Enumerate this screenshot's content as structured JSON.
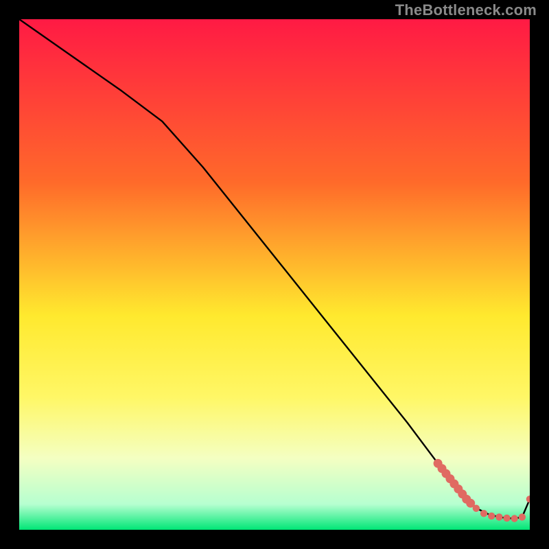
{
  "attribution": "TheBottleneck.com",
  "colors": {
    "line": "#000000",
    "markers": "#e06a62",
    "frame": "#000000",
    "gradient_top": "#ff1a44",
    "gradient_mid_upper": "#ff8a2a",
    "gradient_mid": "#ffe92e",
    "gradient_lower": "#f7ffb0",
    "gradient_bottom": "#00e676"
  },
  "chart_data": {
    "type": "line",
    "title": "",
    "xlabel": "",
    "ylabel": "",
    "xlim": [
      0,
      100
    ],
    "ylim": [
      0,
      100
    ],
    "series": [
      {
        "name": "curve",
        "x": [
          0,
          10,
          20,
          28,
          36,
          44,
          52,
          60,
          68,
          76,
          82,
          85,
          88,
          90,
          92,
          94,
          95.5,
          97,
          98.5,
          100
        ],
        "y": [
          100,
          93,
          86,
          80,
          71,
          61,
          51,
          41,
          31,
          21,
          13,
          9,
          5.5,
          4,
          3,
          2.5,
          2.3,
          2.2,
          2.5,
          6
        ]
      }
    ],
    "markers": {
      "name": "highlight-points",
      "points": [
        {
          "x": 82,
          "y": 13
        },
        {
          "x": 82.8,
          "y": 12
        },
        {
          "x": 83.6,
          "y": 11
        },
        {
          "x": 84.4,
          "y": 10
        },
        {
          "x": 85.2,
          "y": 9
        },
        {
          "x": 86.0,
          "y": 8
        },
        {
          "x": 86.8,
          "y": 7
        },
        {
          "x": 87.6,
          "y": 6
        },
        {
          "x": 88.4,
          "y": 5.2
        },
        {
          "x": 89.5,
          "y": 4.2
        },
        {
          "x": 91.0,
          "y": 3.2
        },
        {
          "x": 92.5,
          "y": 2.7
        },
        {
          "x": 94.0,
          "y": 2.5
        },
        {
          "x": 95.5,
          "y": 2.3
        },
        {
          "x": 97.0,
          "y": 2.2
        },
        {
          "x": 98.5,
          "y": 2.5
        },
        {
          "x": 100,
          "y": 6
        }
      ]
    }
  }
}
